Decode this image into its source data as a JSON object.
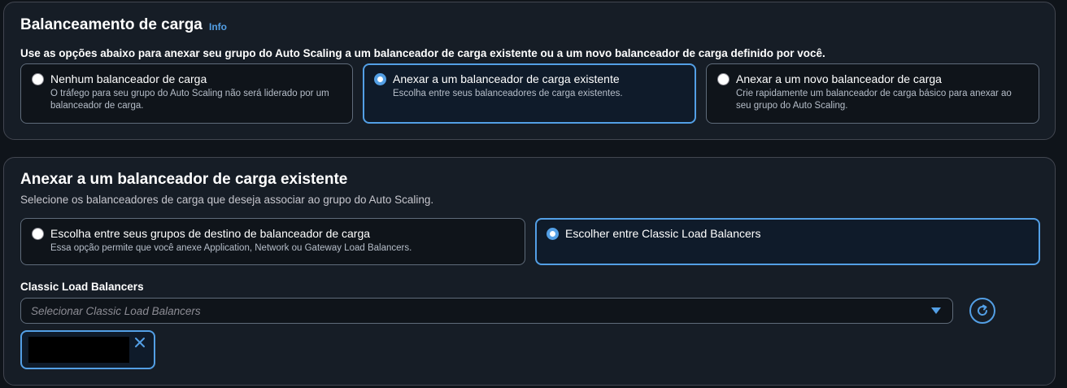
{
  "load_balancing": {
    "title": "Balanceamento de carga",
    "info": "Info",
    "description": "Use as opções abaixo para anexar seu grupo do Auto Scaling a um balanceador de carga existente ou a um novo balanceador de carga definido por você.",
    "options": [
      {
        "title": "Nenhum balanceador de carga",
        "subtitle": "O tráfego para seu grupo do Auto Scaling não será liderado por um balanceador de carga.",
        "selected": false
      },
      {
        "title": "Anexar a um balanceador de carga existente",
        "subtitle": "Escolha entre seus balanceadores de carga existentes.",
        "selected": true
      },
      {
        "title": "Anexar a um novo balanceador de carga",
        "subtitle": "Crie rapidamente um balanceador de carga básico para anexar ao seu grupo do Auto Scaling.",
        "selected": false
      }
    ]
  },
  "attach_existing": {
    "title": "Anexar a um balanceador de carga existente",
    "description": "Selecione os balanceadores de carga que deseja associar ao grupo do Auto Scaling.",
    "options": [
      {
        "title": "Escolha entre seus grupos de destino de balanceador de carga",
        "subtitle": "Essa opção permite que você anexe Application, Network ou Gateway Load Balancers.",
        "selected": false
      },
      {
        "title": "Escolher entre Classic Load Balancers",
        "subtitle": "",
        "selected": true
      }
    ],
    "field_label": "Classic Load Balancers",
    "select_placeholder": "Selecionar Classic Load Balancers",
    "token_value_redacted": true
  },
  "icons": {
    "caret": "caret-down-icon",
    "refresh": "refresh-icon",
    "remove": "close-icon"
  },
  "colors": {
    "accent": "#539fe5",
    "background": "#0f141a",
    "panel": "#161d26",
    "border": "#424650"
  }
}
